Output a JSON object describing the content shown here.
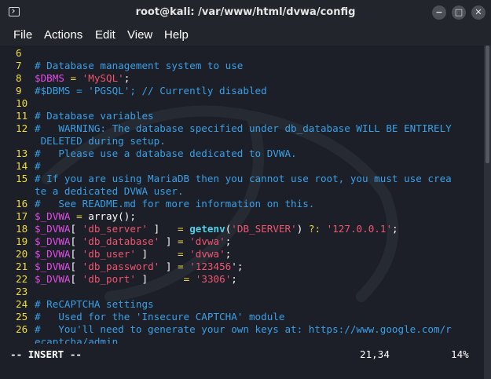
{
  "window": {
    "title": "root@kali: /var/www/html/dvwa/config",
    "buttons": {
      "minimize": "−",
      "maximize": "□",
      "close": "✕"
    }
  },
  "menu": [
    "File",
    "Actions",
    "Edit",
    "View",
    "Help"
  ],
  "editor": {
    "lines": [
      {
        "n": "6",
        "segs": []
      },
      {
        "n": "7",
        "segs": [
          {
            "t": "# Database management system to use",
            "c": "comment"
          }
        ]
      },
      {
        "n": "8",
        "segs": [
          {
            "t": "$DBMS",
            "c": "var"
          },
          {
            "t": " = ",
            "c": "op"
          },
          {
            "t": "'MySQL'",
            "c": "str"
          },
          {
            "t": ";",
            "c": "plain"
          }
        ]
      },
      {
        "n": "9",
        "segs": [
          {
            "t": "#$DBMS = 'PGSQL'; // Currently disabled",
            "c": "comment"
          }
        ]
      },
      {
        "n": "10",
        "segs": []
      },
      {
        "n": "11",
        "segs": [
          {
            "t": "# Database variables",
            "c": "comment"
          }
        ]
      },
      {
        "n": "12",
        "segs": [
          {
            "t": "#   WARNING: The database specified under db_database WILL BE ENTIRELY",
            "c": "comment"
          }
        ]
      },
      {
        "n": "",
        "segs": [
          {
            "t": " DELETED during setup.",
            "c": "comment"
          }
        ]
      },
      {
        "n": "13",
        "segs": [
          {
            "t": "#   Please use a database dedicated to DVWA.",
            "c": "comment"
          }
        ]
      },
      {
        "n": "14",
        "segs": [
          {
            "t": "#",
            "c": "comment"
          }
        ]
      },
      {
        "n": "15",
        "segs": [
          {
            "t": "# If you are using MariaDB then you cannot use root, you must use crea",
            "c": "comment"
          }
        ]
      },
      {
        "n": "",
        "segs": [
          {
            "t": "te a dedicated DVWA user.",
            "c": "comment"
          }
        ]
      },
      {
        "n": "16",
        "segs": [
          {
            "t": "#   See README.md for more information on this.",
            "c": "comment"
          }
        ]
      },
      {
        "n": "17",
        "segs": [
          {
            "t": "$_DVWA",
            "c": "var"
          },
          {
            "t": " = ",
            "c": "op"
          },
          {
            "t": "array();",
            "c": "plain"
          }
        ]
      },
      {
        "n": "18",
        "segs": [
          {
            "t": "$_DVWA",
            "c": "var"
          },
          {
            "t": "[ ",
            "c": "plain"
          },
          {
            "t": "'db_server'",
            "c": "str"
          },
          {
            "t": " ]   ",
            "c": "plain"
          },
          {
            "t": "=",
            "c": "op"
          },
          {
            "t": " ",
            "c": "plain"
          },
          {
            "t": "getenv",
            "c": "func"
          },
          {
            "t": "(",
            "c": "plain"
          },
          {
            "t": "'DB_SERVER'",
            "c": "str"
          },
          {
            "t": ") ",
            "c": "plain"
          },
          {
            "t": "?:",
            "c": "op"
          },
          {
            "t": " ",
            "c": "plain"
          },
          {
            "t": "'127.0.0.1'",
            "c": "str"
          },
          {
            "t": ";",
            "c": "plain"
          }
        ]
      },
      {
        "n": "19",
        "segs": [
          {
            "t": "$_DVWA",
            "c": "var"
          },
          {
            "t": "[ ",
            "c": "plain"
          },
          {
            "t": "'db_database'",
            "c": "str"
          },
          {
            "t": " ] ",
            "c": "plain"
          },
          {
            "t": "=",
            "c": "op"
          },
          {
            "t": " ",
            "c": "plain"
          },
          {
            "t": "'dvwa'",
            "c": "str"
          },
          {
            "t": ";",
            "c": "plain"
          }
        ]
      },
      {
        "n": "20",
        "segs": [
          {
            "t": "$_DVWA",
            "c": "var"
          },
          {
            "t": "[ ",
            "c": "plain"
          },
          {
            "t": "'db_user'",
            "c": "str"
          },
          {
            "t": " ]     ",
            "c": "plain"
          },
          {
            "t": "=",
            "c": "op"
          },
          {
            "t": " ",
            "c": "plain"
          },
          {
            "t": "'dvwa'",
            "c": "str"
          },
          {
            "t": ";",
            "c": "plain"
          }
        ]
      },
      {
        "n": "21",
        "segs": [
          {
            "t": "$_DVWA",
            "c": "var"
          },
          {
            "t": "[ ",
            "c": "plain"
          },
          {
            "t": "'db_password'",
            "c": "str"
          },
          {
            "t": " ] ",
            "c": "plain"
          },
          {
            "t": "=",
            "c": "op"
          },
          {
            "t": " ",
            "c": "plain"
          },
          {
            "t": "'123456",
            "c": "str"
          },
          {
            "t": "'",
            "c": "cursor"
          },
          {
            "t": ";",
            "c": "plain"
          }
        ]
      },
      {
        "n": "22",
        "segs": [
          {
            "t": "$_DVWA",
            "c": "var"
          },
          {
            "t": "[ ",
            "c": "plain"
          },
          {
            "t": "'db_port'",
            "c": "str"
          },
          {
            "t": " ]      ",
            "c": "plain"
          },
          {
            "t": "=",
            "c": "op"
          },
          {
            "t": " ",
            "c": "plain"
          },
          {
            "t": "'3306'",
            "c": "str"
          },
          {
            "t": ";",
            "c": "plain"
          }
        ]
      },
      {
        "n": "23",
        "segs": []
      },
      {
        "n": "24",
        "segs": [
          {
            "t": "# ReCAPTCHA settings",
            "c": "comment"
          }
        ]
      },
      {
        "n": "25",
        "segs": [
          {
            "t": "#   Used for the 'Insecure CAPTCHA' module",
            "c": "comment"
          }
        ]
      },
      {
        "n": "26",
        "segs": [
          {
            "t": "#   You'll need to generate your own keys at: https://www.google.com/r",
            "c": "comment"
          }
        ]
      },
      {
        "n": "",
        "segs": [
          {
            "t": "ecaptcha/admin",
            "c": "comment"
          }
        ]
      }
    ]
  },
  "status": {
    "mode": "-- INSERT --",
    "position": "21,34",
    "percent": "14%"
  },
  "colors": {
    "comment": "#3aa0e6",
    "variable": "#e64ce6",
    "string": "#f05570",
    "function": "#51d0e9",
    "operator": "#e8d840",
    "line_number": "#eedd3e",
    "background": "#1c1f27"
  },
  "icons": {
    "app": "terminal-icon"
  }
}
